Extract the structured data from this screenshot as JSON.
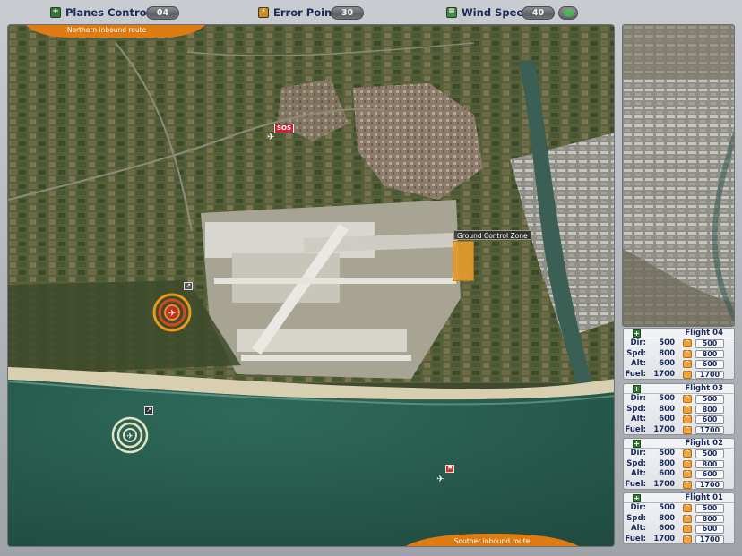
{
  "hud": {
    "planes_controlled": {
      "icon": "plus-icon",
      "label": "Planes Controlled",
      "value": "04"
    },
    "error_points": {
      "icon": "lightning-icon",
      "label": "Error Points",
      "value": "30"
    },
    "wind_speed": {
      "icon": "wind-icon",
      "label": "Wind Speed",
      "value": "40",
      "indicator_color": "#38c23a"
    }
  },
  "map": {
    "routes": {
      "north": "Northern inbound route",
      "south": "Souther inbound route"
    },
    "ground_zone_label": "Ground Control Zone",
    "sos_label": "SOS",
    "colors": {
      "accent": "#e07b12",
      "zone": "#e39b2e",
      "sos": "#d4202a"
    }
  },
  "flights": [
    {
      "title": "Flight 04",
      "rows": [
        {
          "label": "Dir:",
          "value": "500",
          "input": "500"
        },
        {
          "label": "Spd:",
          "value": "800",
          "input": "800"
        },
        {
          "label": "Alt:",
          "value": "600",
          "input": "600"
        },
        {
          "label": "Fuel:",
          "value": "1700",
          "input": "1700"
        }
      ]
    },
    {
      "title": "Flight 03",
      "rows": [
        {
          "label": "Dir:",
          "value": "500",
          "input": "500"
        },
        {
          "label": "Spd:",
          "value": "800",
          "input": "800"
        },
        {
          "label": "Alt:",
          "value": "600",
          "input": "600"
        },
        {
          "label": "Fuel:",
          "value": "1700",
          "input": "1700"
        }
      ]
    },
    {
      "title": "Flight 02",
      "rows": [
        {
          "label": "Dir:",
          "value": "500",
          "input": "500"
        },
        {
          "label": "Spd:",
          "value": "800",
          "input": "800"
        },
        {
          "label": "Alt:",
          "value": "600",
          "input": "600"
        },
        {
          "label": "Fuel:",
          "value": "1700",
          "input": "1700"
        }
      ]
    },
    {
      "title": "Flight 01",
      "rows": [
        {
          "label": "Dir:",
          "value": "500",
          "input": "500"
        },
        {
          "label": "Spd:",
          "value": "800",
          "input": "800"
        },
        {
          "label": "Alt:",
          "value": "600",
          "input": "600"
        },
        {
          "label": "Fuel:",
          "value": "1700",
          "input": "1700"
        }
      ]
    }
  ]
}
